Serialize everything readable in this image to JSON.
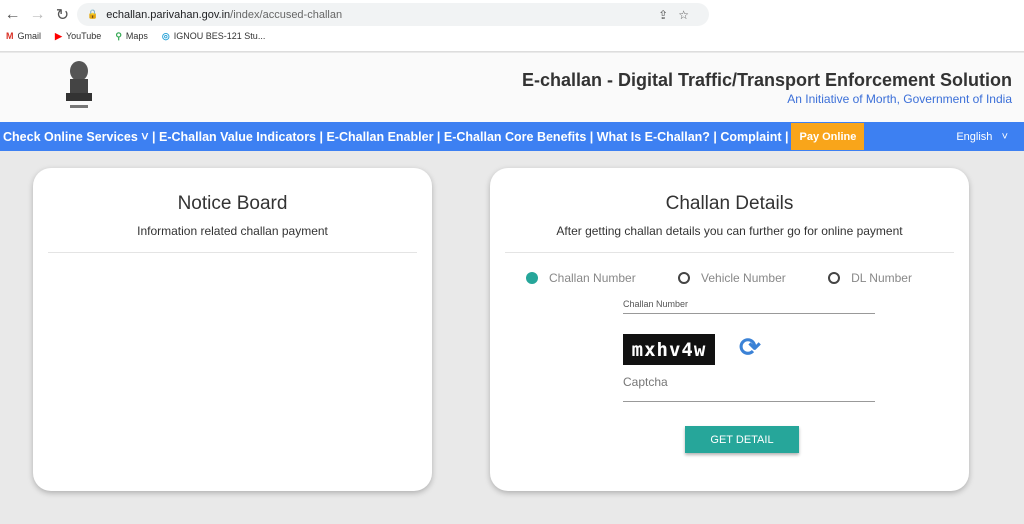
{
  "browser": {
    "url_domain": "echallan.parivahan.gov.in",
    "url_path": "/index/accused-challan",
    "bookmarks": [
      {
        "label": "Gmail",
        "icon": "M"
      },
      {
        "label": "YouTube",
        "icon": "▶"
      },
      {
        "label": "Maps",
        "icon": "⚲"
      },
      {
        "label": "IGNOU BES-121 Stu...",
        "icon": "◎"
      }
    ]
  },
  "header": {
    "title": "E-challan - Digital Traffic/Transport Enforcement Solution",
    "subtitle": "An Initiative of Morth, Government of India"
  },
  "menu": {
    "items": [
      "Check Online Services ˅",
      " | E-Challan Value Indicators",
      " | E-Challan Enabler",
      " | E-Challan Core Benefits",
      " | What Is E-Challan?",
      " | Complaint",
      " |"
    ],
    "pay": "Pay Online",
    "language": "English   ˅"
  },
  "notice": {
    "title": "Notice Board",
    "subtitle": "Information related challan payment"
  },
  "challan": {
    "title": "Challan Details",
    "subtitle": "After getting challan details you can further go for online payment",
    "options": [
      "Challan Number",
      "Vehicle Number",
      "DL Number"
    ],
    "selected": 0,
    "field_label": "Challan Number",
    "captcha_text": "mxhv4w",
    "captcha_placeholder": "Captcha",
    "button": "GET DETAIL"
  },
  "colors": {
    "nav": "#3d80f2",
    "accent": "#26a69a",
    "pay": "#f9a51a"
  }
}
